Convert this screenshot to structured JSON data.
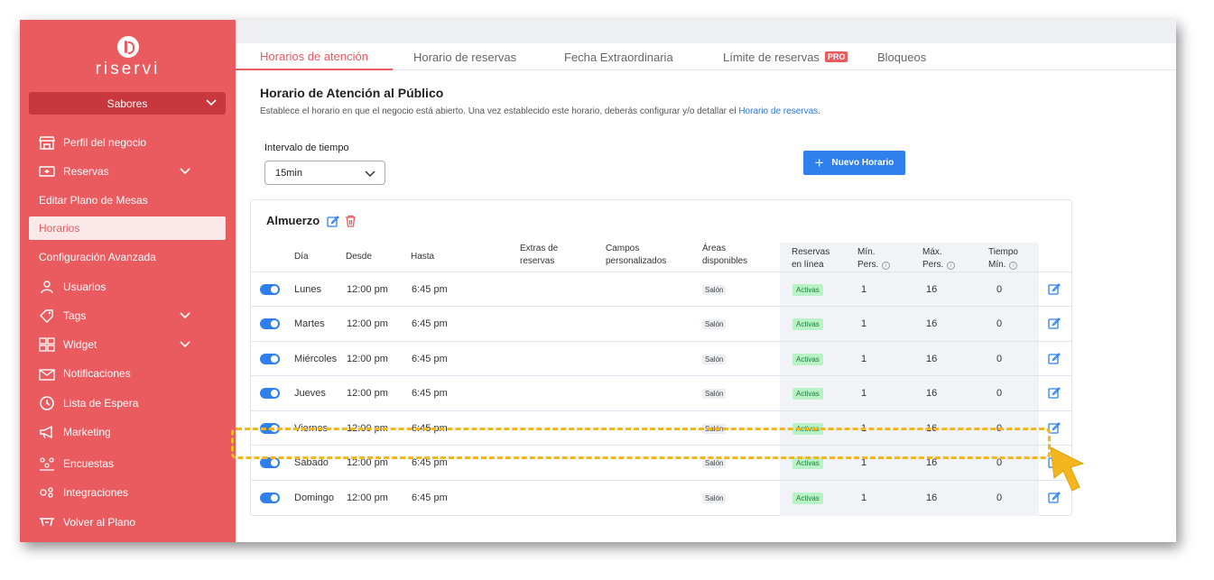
{
  "brand": {
    "logo_text": "riservi"
  },
  "sidebar": {
    "company": "Sabores",
    "items": [
      {
        "label": "Perfil del negocio",
        "icon": "store-icon"
      },
      {
        "label": "Reservas",
        "icon": "ticket-icon"
      },
      {
        "label": "Editar Plano de Mesas"
      },
      {
        "label": "Horarios"
      },
      {
        "label": "Configuración Avanzada"
      },
      {
        "label": "Usuarios",
        "icon": "user-icon"
      },
      {
        "label": "Tags",
        "icon": "tag-icon"
      },
      {
        "label": "Widget",
        "icon": "widget-icon"
      },
      {
        "label": "Notificaciones",
        "icon": "mail-icon"
      },
      {
        "label": "Lista de Espera",
        "icon": "clock-icon"
      },
      {
        "label": "Marketing",
        "icon": "megaphone-icon"
      },
      {
        "label": "Encuestas",
        "icon": "survey-icon"
      },
      {
        "label": "Integraciones",
        "icon": "integrations-icon"
      },
      {
        "label": "Volver al Plano",
        "icon": "floorplan-icon"
      }
    ]
  },
  "tabs": [
    {
      "label": "Horarios de atención"
    },
    {
      "label": "Horario de reservas"
    },
    {
      "label": "Fecha Extraordinaria"
    },
    {
      "label": "Límite de reservas",
      "badge": "PRO"
    },
    {
      "label": "Bloqueos"
    }
  ],
  "header": {
    "title": "Horario de Atención al Público",
    "description": "Establece el horario en que el negocio está abierto. Una vez establecido este horario, deberás configurar y/o detallar el ",
    "description_link": "Horario de reservas",
    "description_end": "."
  },
  "interval": {
    "label": "Intervalo de tiempo",
    "value": "15min"
  },
  "new_button": {
    "label": "Nuevo Horario"
  },
  "schedule": {
    "name": "Almuerzo",
    "columns": {
      "dia": "Día",
      "desde": "Desde",
      "hasta": "Hasta",
      "extras_1": "Extras de",
      "extras_2": "reservas",
      "campos_1": "Campos",
      "campos_2": "personalizados",
      "areas_1": "Áreas",
      "areas_2": "disponibles",
      "reservas_1": "Reservas",
      "reservas_2": "en línea",
      "min_1": "Mín.",
      "min_2": "Pers.",
      "max_1": "Máx.",
      "max_2": "Pers.",
      "tiempo_1": "Tiempo",
      "tiempo_2": "Mín."
    },
    "rows": [
      {
        "day": "Lunes",
        "from": "12:00 pm",
        "to": "6:45 pm",
        "area": "Salón",
        "status": "Activas",
        "min": "1",
        "max": "16",
        "time": "0"
      },
      {
        "day": "Martes",
        "from": "12:00 pm",
        "to": "6:45 pm",
        "area": "Salón",
        "status": "Activas",
        "min": "1",
        "max": "16",
        "time": "0"
      },
      {
        "day": "Miércoles",
        "from": "12:00 pm",
        "to": "6:45 pm",
        "area": "Salón",
        "status": "Activas",
        "min": "1",
        "max": "16",
        "time": "0"
      },
      {
        "day": "Jueves",
        "from": "12:00 pm",
        "to": "6:45 pm",
        "area": "Salón",
        "status": "Activas",
        "min": "1",
        "max": "16",
        "time": "0"
      },
      {
        "day": "Viernes",
        "from": "12:00 pm",
        "to": "6:45 pm",
        "area": "Salón",
        "status": "Activas",
        "min": "1",
        "max": "16",
        "time": "0"
      },
      {
        "day": "Sábado",
        "from": "12:00 pm",
        "to": "6:45 pm",
        "area": "Salón",
        "status": "Activas",
        "min": "1",
        "max": "16",
        "time": "0"
      },
      {
        "day": "Domingo",
        "from": "12:00 pm",
        "to": "6:45 pm",
        "area": "Salón",
        "status": "Activas",
        "min": "1",
        "max": "16",
        "time": "0"
      }
    ]
  },
  "colors": {
    "brand": "#ea5b60",
    "primary": "#2f80ed",
    "highlight": "#f3b61f"
  }
}
